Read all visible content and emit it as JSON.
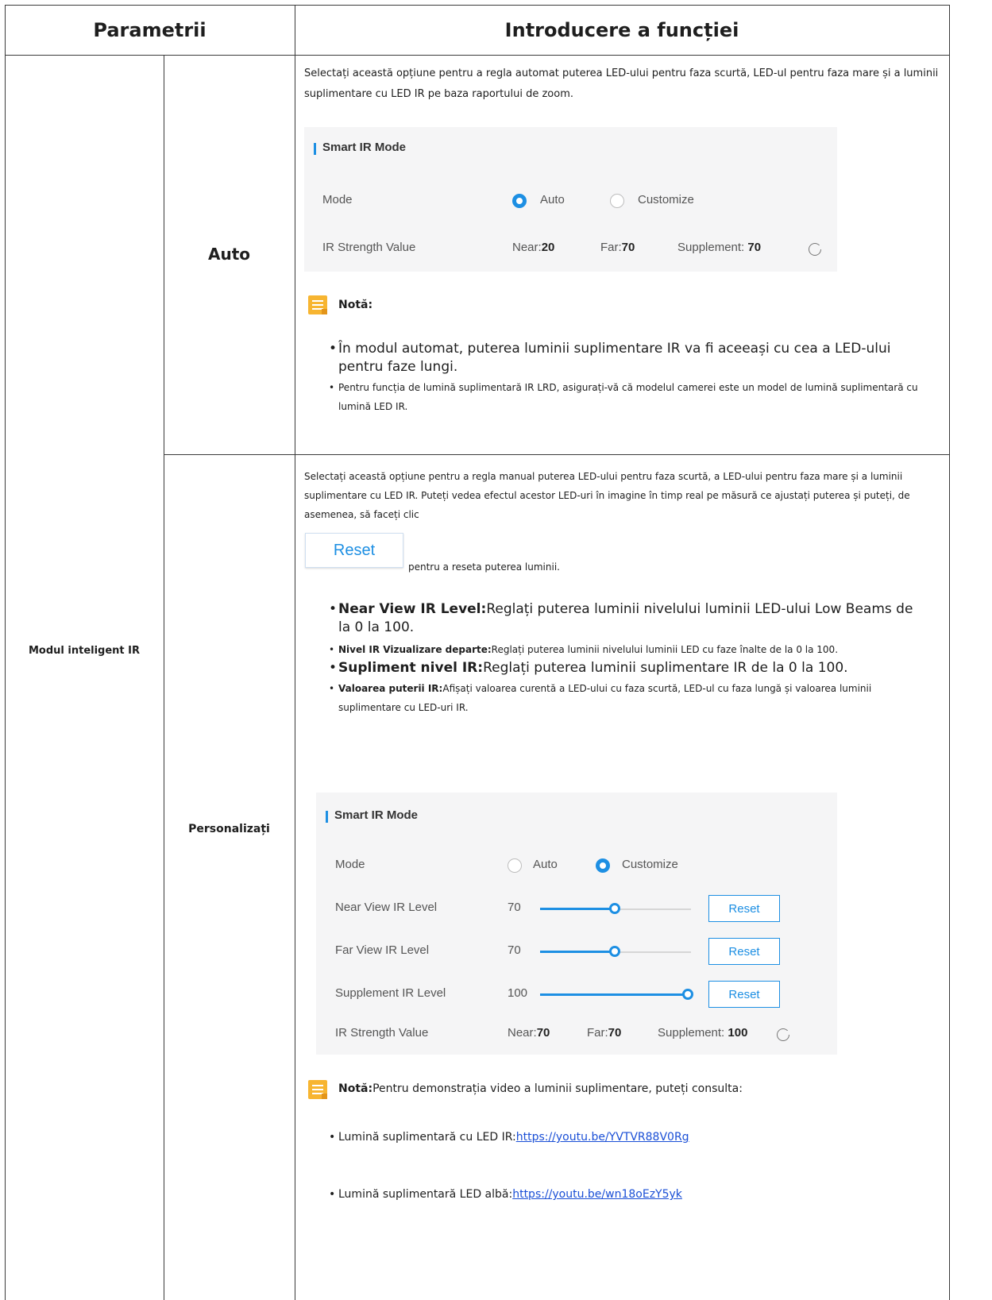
{
  "header": {
    "col1": "Parametrii",
    "col2": "Introducere a funcției"
  },
  "param_group": "Modul inteligent IR",
  "auto_row": {
    "label": "Auto",
    "description": "Selectați această opțiune pentru a regla automat puterea LED-ului pentru faza scurtă, LED-ul pentru faza mare și a luminii suplimentare cu LED IR pe baza raportului de zoom.",
    "panel": {
      "title": "Smart IR Mode",
      "mode_label": "Mode",
      "opt_auto": "Auto",
      "opt_custom": "Customize",
      "selected": "Auto",
      "strength_label": "IR Strength Value",
      "near_label": "Near:",
      "near_value": "20",
      "far_label": "Far:",
      "far_value": "70",
      "supp_label": "Supplement:",
      "supp_value": "70"
    },
    "note_title": "Notă:",
    "note_items": [
      "În modul automat, puterea luminii suplimentare IR va fi aceeași cu cea a LED-ului pentru faze lungi.",
      "Pentru funcția de lumină suplimentară IR LRD, asigurați-vă că modelul camerei este un model de lumină suplimentară cu lumină LED IR."
    ]
  },
  "custom_row": {
    "label": "Personalizați",
    "description": "Selectați această opțiune pentru a regla manual puterea LED-ului pentru faza scurtă, a LED-ului pentru faza mare și a luminii suplimentare cu LED IR. Puteți vedea efectul acestor LED-uri în imagine în timp real pe măsură ce ajustați puterea și puteți, de asemenea, să faceți clic",
    "reset_button": "Reset",
    "after_reset": "pentru a reseta puterea luminii.",
    "bullets": [
      {
        "term": "Near View IR Level:",
        "text": "Reglați puterea luminii nivelului luminii LED-ului Low Beams de la 0 la 100."
      },
      {
        "term": "Nivel IR Vizualizare departe:",
        "text": "Reglați puterea luminii nivelului luminii LED cu faze înalte de la 0 la 100."
      },
      {
        "term": "Supliment nivel IR:",
        "text": "Reglați puterea luminii suplimentare IR de la 0 la 100."
      },
      {
        "term": "Valoarea puterii IR:",
        "text": "Afișați valoarea curentă a LED-ului cu faza scurtă, LED-ul cu faza lungă și valoarea luminii suplimentare cu LED-uri IR."
      }
    ],
    "panel": {
      "title": "Smart IR Mode",
      "mode_label": "Mode",
      "opt_auto": "Auto",
      "opt_custom": "Customize",
      "selected": "Customize",
      "sliders": [
        {
          "label": "Near View IR Level",
          "value": "70",
          "level": 0.5,
          "reset": "Reset"
        },
        {
          "label": "Far View IR Level",
          "value": "70",
          "level": 0.5,
          "reset": "Reset"
        },
        {
          "label": "Supplement IR Level",
          "value": "100",
          "level": 1.0,
          "reset": "Reset"
        }
      ],
      "strength_label": "IR Strength Value",
      "near_label": "Near:",
      "near_value": "70",
      "far_label": "Far:",
      "far_value": "70",
      "supp_label": "Supplement:",
      "supp_value": "100"
    },
    "note_title": "Notă:",
    "note_text": "Pentru demonstrația video a luminii suplimentare, puteți consulta:",
    "links": [
      {
        "label": "Lumină suplimentară cu LED IR:",
        "url": "https://youtu.be/YVTVR88V0Rg"
      },
      {
        "label": "Lumină suplimentară LED albă:",
        "url": "https://youtu.be/wn18oEzY5yk"
      }
    ]
  }
}
